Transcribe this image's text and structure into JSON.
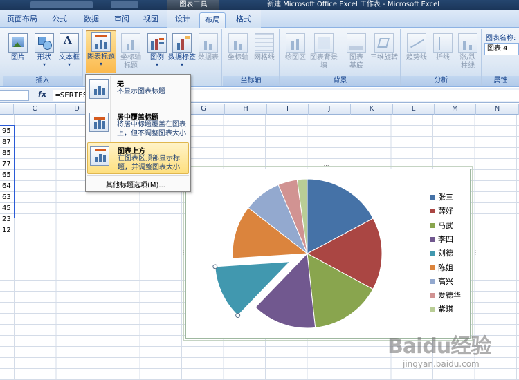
{
  "title_bar": {
    "chart_tools": "图表工具",
    "window_title": "新建 Microsoft Office Excel 工作表 - Microsoft Excel"
  },
  "tabs": [
    {
      "label": "页面布局"
    },
    {
      "label": "公式"
    },
    {
      "label": "数据"
    },
    {
      "label": "审阅"
    },
    {
      "label": "视图"
    },
    {
      "label": "设计"
    },
    {
      "label": "布局",
      "active": true
    },
    {
      "label": "格式"
    }
  ],
  "ribbon": {
    "insert": {
      "label": "插入",
      "buttons": [
        {
          "label": "图片"
        },
        {
          "label": "形状"
        },
        {
          "label": "文本框"
        }
      ]
    },
    "labels": {
      "buttons": [
        {
          "label": "图表标题"
        },
        {
          "label": "坐标轴\n标题"
        },
        {
          "label": "图例"
        },
        {
          "label": "数据标签"
        },
        {
          "label": "数据表"
        }
      ]
    },
    "axes": {
      "label": "坐标轴",
      "buttons": [
        {
          "label": "坐标轴"
        },
        {
          "label": "网格线"
        }
      ]
    },
    "background": {
      "label": "背景",
      "buttons": [
        {
          "label": "绘图区"
        },
        {
          "label": "图表背景墙"
        },
        {
          "label": "图表\n基底"
        },
        {
          "label": "三维旋转"
        }
      ]
    },
    "analysis": {
      "label": "分析",
      "buttons": [
        {
          "label": "趋势线"
        },
        {
          "label": "折线"
        },
        {
          "label": "涨/跌\n柱线"
        }
      ]
    },
    "properties": {
      "label": "属性",
      "chart_name_label": "图表名称:",
      "chart_name_value": "图表 4"
    }
  },
  "formula_bar": {
    "fx": "fx",
    "formula": "=SERIES(                        eet1!$B$2:$B$10,1)"
  },
  "columns": [
    "C",
    "D",
    "E",
    "F",
    "G",
    "H",
    "I",
    "J",
    "K",
    "L",
    "M",
    "N"
  ],
  "cell_values": [
    "95",
    "87",
    "85",
    "77",
    "65",
    "64",
    "63",
    "45",
    "23",
    "12"
  ],
  "menu": {
    "items": [
      {
        "title": "无",
        "desc": "不显示图表标题"
      },
      {
        "title": "居中覆盖标题",
        "desc": "将居中标题覆盖在图表上，但不调整图表大小"
      },
      {
        "title": "图表上方",
        "desc": "在图表区顶部显示标题，并调整图表大小"
      }
    ],
    "more": "其他标题选项(M)..."
  },
  "chart_data": {
    "type": "pie",
    "categories": [
      "张三",
      "薛好",
      "马武",
      "李四",
      "刘德",
      "陈姐",
      "高兴",
      "爱德华",
      "紫琪"
    ],
    "values": [
      95,
      87,
      85,
      77,
      65,
      64,
      45,
      23,
      12
    ],
    "exploded": "刘德",
    "colors": [
      "#4572a7",
      "#aa4643",
      "#89a54e",
      "#71588f",
      "#4198af",
      "#db843d",
      "#93a9cf",
      "#d19392",
      "#b9cd96"
    ],
    "legend": "right"
  },
  "watermark": {
    "line1": "Baidu经验",
    "line2": "jingyan.baidu.com"
  }
}
